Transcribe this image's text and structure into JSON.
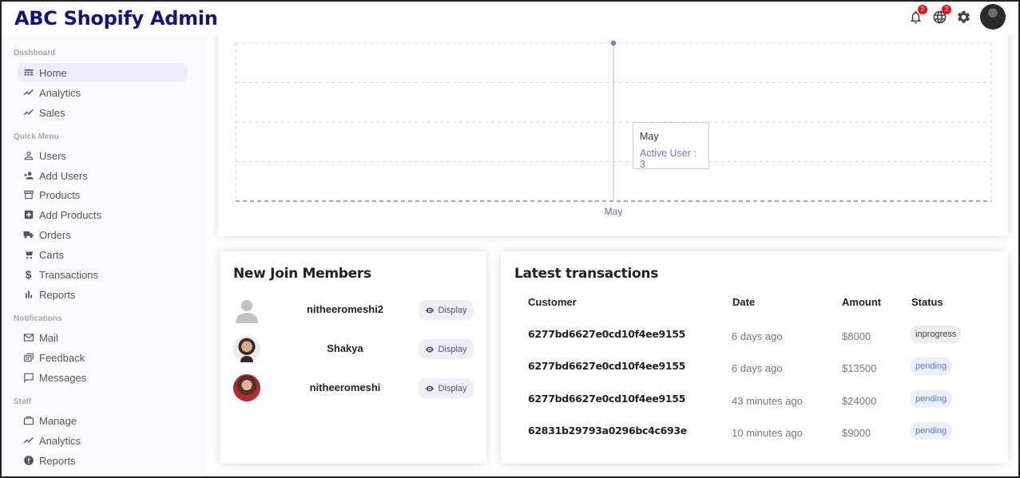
{
  "app": {
    "title": "ABC Shopify Admin"
  },
  "topbar": {
    "notifications_count": "2",
    "language_count": "2",
    "icons": [
      "bell-icon",
      "globe-icon",
      "gear-icon",
      "avatar"
    ]
  },
  "sidebar": {
    "sections": [
      {
        "title": "Dashboard",
        "items": [
          {
            "label": "Home",
            "icon": "dashboard-icon",
            "active": true
          },
          {
            "label": "Analytics",
            "icon": "trending-icon"
          },
          {
            "label": "Sales",
            "icon": "trending-icon"
          }
        ]
      },
      {
        "title": "Quick Menu",
        "items": [
          {
            "label": "Users",
            "icon": "person-icon"
          },
          {
            "label": "Add Users",
            "icon": "person-add-icon"
          },
          {
            "label": "Products",
            "icon": "store-icon"
          },
          {
            "label": "Add Products",
            "icon": "plus-box-icon"
          },
          {
            "label": "Orders",
            "icon": "truck-icon"
          },
          {
            "label": "Carts",
            "icon": "cart-icon"
          },
          {
            "label": "Transactions",
            "icon": "dollar-icon"
          },
          {
            "label": "Reports",
            "icon": "bar-chart-icon"
          }
        ]
      },
      {
        "title": "Notifications",
        "items": [
          {
            "label": "Mail",
            "icon": "mail-icon"
          },
          {
            "label": "Feedback",
            "icon": "feedback-icon"
          },
          {
            "label": "Messages",
            "icon": "message-icon"
          }
        ]
      },
      {
        "title": "Staff",
        "items": [
          {
            "label": "Manage",
            "icon": "briefcase-icon"
          },
          {
            "label": "Analytics",
            "icon": "trending-icon"
          },
          {
            "label": "Reports",
            "icon": "alert-circle-icon"
          }
        ]
      }
    ]
  },
  "chart_data": {
    "type": "line",
    "categories": [
      "May"
    ],
    "series": [
      {
        "name": "Active User",
        "values": [
          3
        ]
      }
    ],
    "grid": true
  },
  "tooltip": {
    "label": "May",
    "value_text": "Active User : 3"
  },
  "members": {
    "title": "New Join Members",
    "button_label": "Display",
    "items": [
      {
        "name": "nitheeromeshi2",
        "avatar": "default"
      },
      {
        "name": "Shakya",
        "avatar": "photo-male"
      },
      {
        "name": "nitheeromeshi",
        "avatar": "photo-female"
      }
    ]
  },
  "transactions": {
    "title": "Latest transactions",
    "columns": [
      "Customer",
      "Date",
      "Amount",
      "Status"
    ],
    "rows": [
      {
        "customer": "6277bd6627e0cd10f4ee9155",
        "date": "6 days ago",
        "amount": "$8000",
        "status": "inprogress"
      },
      {
        "customer": "6277bd6627e0cd10f4ee9155",
        "date": "6 days ago",
        "amount": "$13500",
        "status": "pending"
      },
      {
        "customer": "6277bd6627e0cd10f4ee9155",
        "date": "43 minutes ago",
        "amount": "$24000",
        "status": "pending"
      },
      {
        "customer": "62831b29793a0296bc4c693e",
        "date": "10 minutes ago",
        "amount": "$9000",
        "status": "pending"
      }
    ]
  }
}
